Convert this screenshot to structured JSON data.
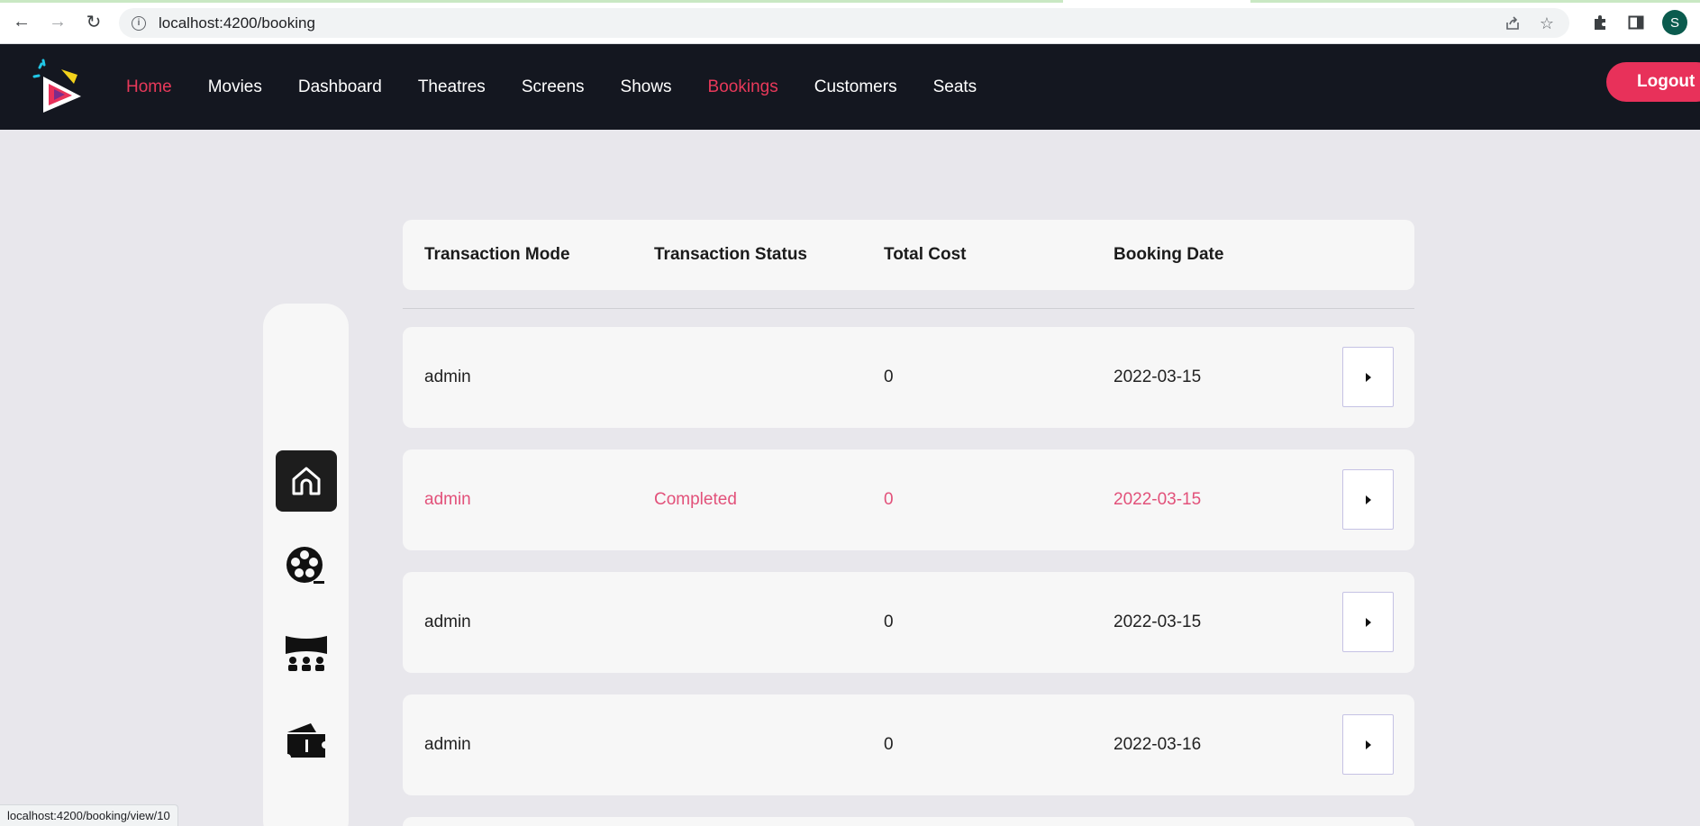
{
  "browser": {
    "url": "localhost:4200/booking",
    "profile_initial": "S",
    "status_url": "localhost:4200/booking/view/10"
  },
  "nav": {
    "items": [
      {
        "label": "Home",
        "active": true
      },
      {
        "label": "Movies",
        "active": false
      },
      {
        "label": "Dashboard",
        "active": false
      },
      {
        "label": "Theatres",
        "active": false
      },
      {
        "label": "Screens",
        "active": false
      },
      {
        "label": "Shows",
        "active": false
      },
      {
        "label": "Bookings",
        "active": true
      },
      {
        "label": "Customers",
        "active": false
      },
      {
        "label": "Seats",
        "active": false
      }
    ],
    "logout_label": "Logout"
  },
  "sidebar": {
    "items": [
      {
        "icon": "home-icon",
        "active": true
      },
      {
        "icon": "film-reel-icon",
        "active": false
      },
      {
        "icon": "theatre-screen-icon",
        "active": false
      },
      {
        "icon": "ticket-icon",
        "active": false
      }
    ]
  },
  "table": {
    "headers": [
      "Transaction Mode",
      "Transaction Status",
      "Total Cost",
      "Booking Date"
    ],
    "rows": [
      {
        "mode": "admin",
        "status": "",
        "cost": "0",
        "date": "2022-03-15",
        "highlight": false
      },
      {
        "mode": "admin",
        "status": "Completed",
        "cost": "0",
        "date": "2022-03-15",
        "highlight": true
      },
      {
        "mode": "admin",
        "status": "",
        "cost": "0",
        "date": "2022-03-15",
        "highlight": false
      },
      {
        "mode": "admin",
        "status": "",
        "cost": "0",
        "date": "2022-03-16",
        "highlight": false
      }
    ]
  },
  "colors": {
    "navbar_bg": "#141720",
    "accent": "#e8395a",
    "highlight_text": "#e2517a",
    "page_bg": "#e8e7ec"
  }
}
